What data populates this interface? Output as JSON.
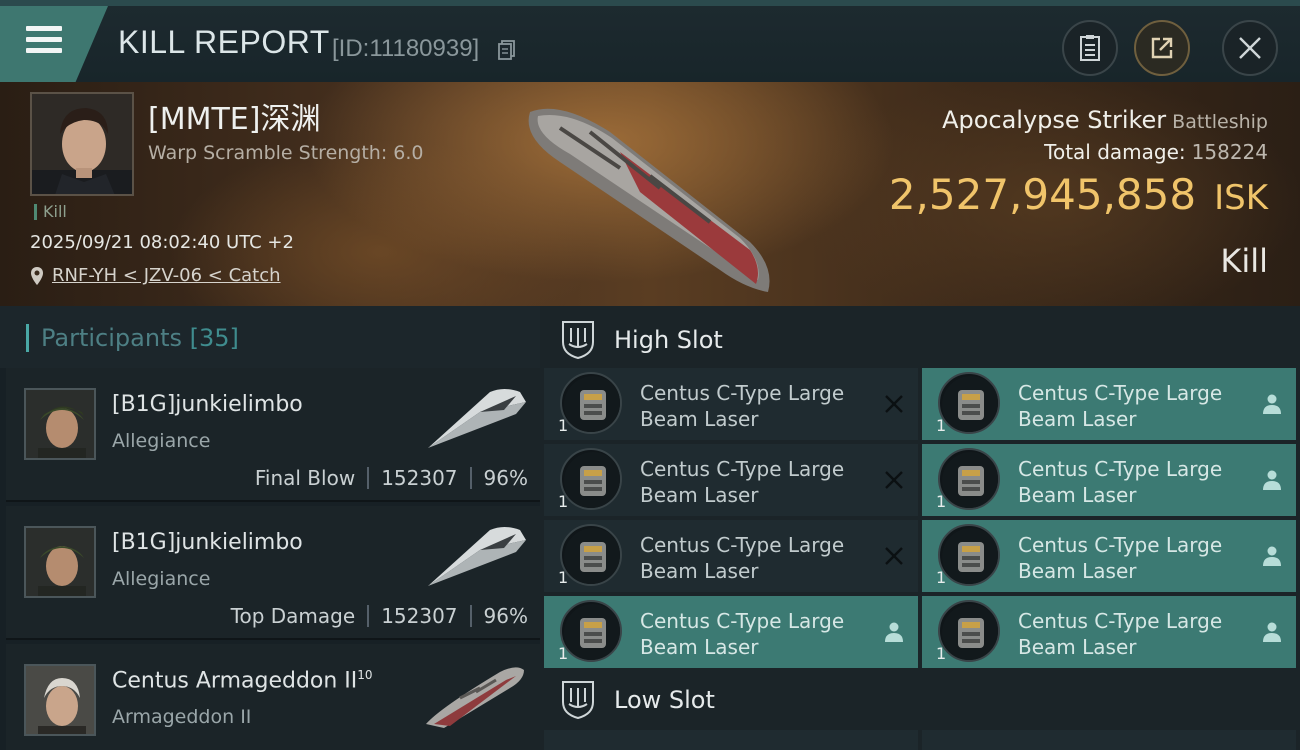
{
  "header": {
    "title": "KILL REPORT",
    "report_id": "[ID:11180939]"
  },
  "banner": {
    "pilot_name": "[MMTE]深渊",
    "warp_scramble": "Warp Scramble Strength: 6.0",
    "kill_tag": "Kill",
    "datetime": "2025/09/21 08:02:40 UTC +2",
    "location": "RNF-YH < JZV-06 < Catch",
    "ship_name": "Apocalypse Striker",
    "ship_class": "Battleship",
    "total_damage_label": "Total damage:",
    "total_damage": "158224",
    "isk_value": "2,527,945,858",
    "isk_unit": "ISK",
    "result": "Kill"
  },
  "participants": {
    "title": "Participants",
    "count": "[35]",
    "list": [
      {
        "name": "[B1G]junkielimbo",
        "ship": "Allegiance",
        "role": "Final Blow",
        "damage": "152307",
        "percent": "96%"
      },
      {
        "name": "[B1G]junkielimbo",
        "ship": "Allegiance",
        "role": "Top Damage",
        "damage": "152307",
        "percent": "96%"
      },
      {
        "name": "Centus Armageddon II",
        "name_sup": "10",
        "ship": "Armageddon II"
      }
    ]
  },
  "slots": {
    "high_label": "High Slot",
    "low_label": "Low Slot",
    "modules": [
      {
        "name": "Centus C-Type Large Beam Laser",
        "qty": "1",
        "state": "destroyed"
      },
      {
        "name": "Centus C-Type Large Beam Laser",
        "qty": "1",
        "state": "dropped"
      },
      {
        "name": "Centus C-Type Large Beam Laser",
        "qty": "1",
        "state": "destroyed"
      },
      {
        "name": "Centus C-Type Large Beam Laser",
        "qty": "1",
        "state": "dropped"
      },
      {
        "name": "Centus C-Type Large Beam Laser",
        "qty": "1",
        "state": "destroyed"
      },
      {
        "name": "Centus C-Type Large Beam Laser",
        "qty": "1",
        "state": "dropped"
      },
      {
        "name": "Centus C-Type Large Beam Laser",
        "qty": "1",
        "state": "dropped"
      },
      {
        "name": "Centus C-Type Large Beam Laser",
        "qty": "1",
        "state": "dropped"
      }
    ]
  },
  "icons": {
    "menu": "hamburger-menu-icon",
    "copy": "copy-icon",
    "clipboard": "clipboard-icon",
    "export": "export-icon",
    "close": "close-icon",
    "location": "location-pin-icon",
    "destroyed": "x-icon",
    "dropped": "person-icon",
    "slot": "slot-badge-icon"
  },
  "colors": {
    "accent": "#3c7a73",
    "isk": "#f0c46a",
    "participants_title": "#4d7f84"
  }
}
